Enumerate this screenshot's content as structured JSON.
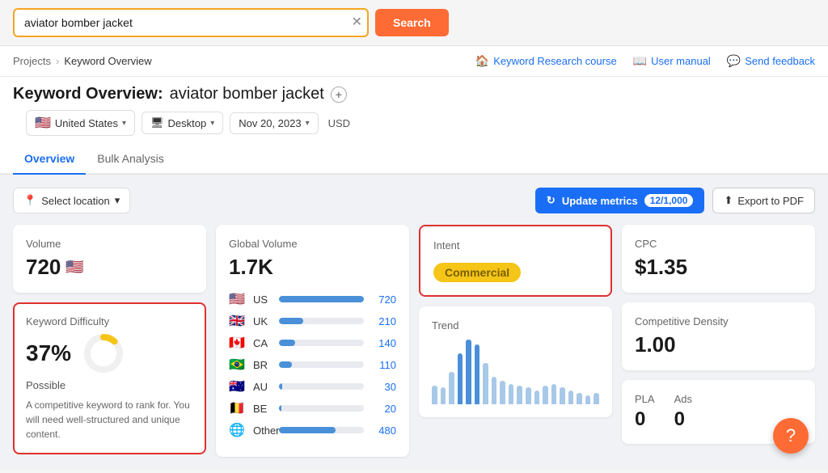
{
  "search": {
    "query": "aviator bomber jacket",
    "button_label": "Search",
    "clear_title": "Clear"
  },
  "nav": {
    "breadcrumb_parent": "Projects",
    "breadcrumb_current": "Keyword Overview",
    "links": [
      {
        "id": "keyword-research-course",
        "icon": "🏠",
        "label": "Keyword Research course"
      },
      {
        "id": "user-manual",
        "icon": "📖",
        "label": "User manual"
      },
      {
        "id": "send-feedback",
        "icon": "💬",
        "label": "Send feedback"
      }
    ]
  },
  "page": {
    "title_prefix": "Keyword Overview:",
    "keyword": "aviator bomber jacket"
  },
  "filters": {
    "country": "United States",
    "country_flag": "🇺🇸",
    "device": "Desktop",
    "device_icon": "🖥",
    "date": "Nov 20, 2023",
    "currency": "USD"
  },
  "tabs": [
    {
      "id": "overview",
      "label": "Overview",
      "active": true
    },
    {
      "id": "bulk-analysis",
      "label": "Bulk Analysis",
      "active": false
    }
  ],
  "toolbar": {
    "select_location_label": "Select location",
    "update_metrics_label": "Update metrics",
    "update_metrics_count": "12/1,000",
    "export_label": "Export to PDF"
  },
  "cards": {
    "volume": {
      "label": "Volume",
      "value": "720",
      "flag": "🇺🇸"
    },
    "kd": {
      "label": "Keyword Difficulty",
      "value": "37%",
      "sub": "Possible",
      "desc": "A competitive keyword to rank for. You will need well-structured and unique content.",
      "percent": 37
    },
    "global_volume": {
      "label": "Global Volume",
      "value": "1.7K",
      "countries": [
        {
          "flag": "🇺🇸",
          "code": "US",
          "value": 720,
          "max": 720,
          "display": "720"
        },
        {
          "flag": "🇬🇧",
          "code": "UK",
          "value": 210,
          "max": 720,
          "display": "210"
        },
        {
          "flag": "🇨🇦",
          "code": "CA",
          "value": 140,
          "max": 720,
          "display": "140"
        },
        {
          "flag": "🇧🇷",
          "code": "BR",
          "value": 110,
          "max": 720,
          "display": "110"
        },
        {
          "flag": "🇦🇺",
          "code": "AU",
          "value": 30,
          "max": 720,
          "display": "30"
        },
        {
          "flag": "🇧🇪",
          "code": "BE",
          "value": 20,
          "max": 720,
          "display": "20"
        },
        {
          "flag": "",
          "code": "Other",
          "value": 480,
          "max": 720,
          "display": "480"
        }
      ]
    },
    "intent": {
      "label": "Intent",
      "badge": "Commercial"
    },
    "trend": {
      "label": "Trend",
      "bars": [
        20,
        18,
        35,
        55,
        70,
        65,
        45,
        30,
        25,
        22,
        20,
        18,
        15,
        20,
        22,
        18,
        15,
        12,
        10,
        12
      ]
    },
    "cpc": {
      "label": "CPC",
      "value": "$1.35"
    },
    "competitive_density": {
      "label": "Competitive Density",
      "value": "1.00"
    },
    "pla": {
      "label": "PLA",
      "value": "0"
    },
    "ads": {
      "label": "Ads",
      "value": "0"
    }
  },
  "fab": {
    "icon": "?"
  }
}
